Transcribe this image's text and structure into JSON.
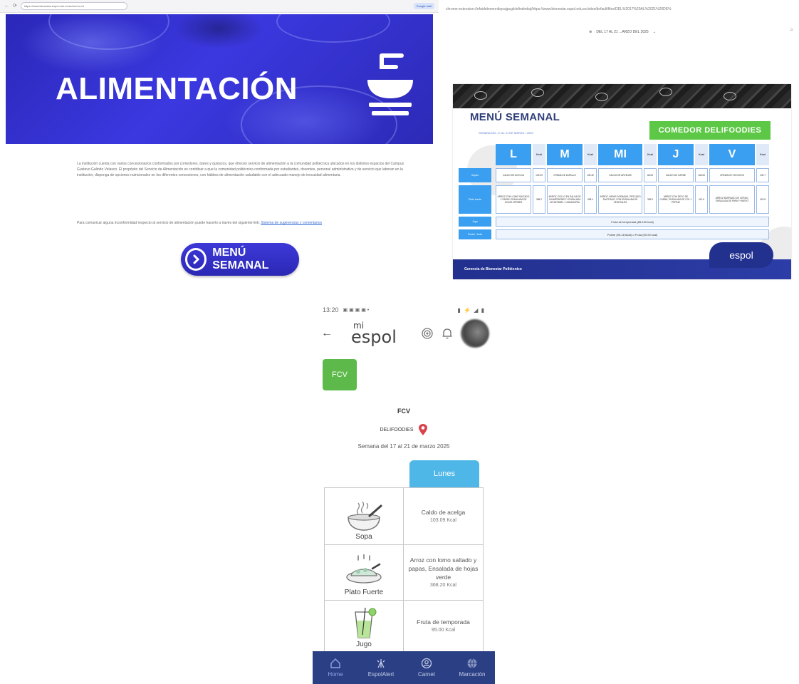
{
  "website": {
    "url": "https://www.bienestar.espol.edu.ec/es/menu-cvl",
    "browser_button": "Google mail",
    "hero_title": "ALIMENTACIÓN",
    "paragraph": "La institución cuenta con varios concesionarios conformados por comedores, bares y quioscos, que ofrecen servicio de alimentación a la comunidad politécnica ubicados en los distintos espacios del Campus Gustavo Galindo Velasco. El propósito del Servicio de Alimentación es contribuir a que la comunidad politécnica conformada por estudiantes, docentes, personal administrativo y de servicio que laboran en la institución, disponga de opciones nutricionales en los diferentes concesiones, con hábitos de alimentación saludable con el adecuado manejo de inocuidad alimentaria.",
    "contact_text": "Para comunicar alguna inconformidad respecto al servicio de alimentación puede hacerlo a través del siguiente link:",
    "contact_link": "Sistema de sugerencias y comentarios",
    "menu_button": "MENÚ SEMANAL"
  },
  "pdf": {
    "url": "chrome-extension://efaidnbmnnnibpcajpcglclefindmkaj/https://www.bienestar.espol.edu.ec/sites/default/files/DEL%2017%20AL%2021%20DE%",
    "toolbar_title": "DEL 17 AL 21 ...ARZO DEL 2025",
    "title": "MENÚ SEMANAL",
    "subtitle": "SEMANA DEL 17 AL 21 DE MARZO / 2025",
    "comedor": "COMEDOR DELIFOODIES",
    "kcal_label": "Kcal",
    "days": [
      "L",
      "M",
      "MI",
      "J",
      "V"
    ],
    "row_labels": [
      "Sopas",
      "Plato fuerte",
      "Jugo",
      "Postre / fruta"
    ],
    "sopas": [
      {
        "text": "CALDO DE ACELGA",
        "kcal": "103.09"
      },
      {
        "text": "CREMA DE ZAPALLO",
        "kcal": "135.42"
      },
      {
        "text": "CALDO DE ARVEJAS",
        "kcal": "86.05"
      },
      {
        "text": "CALDO DE CARNE",
        "kcal": "108.54"
      },
      {
        "text": "CREMA DE CHOCHOS",
        "kcal": "139.7"
      }
    ],
    "fuerte": [
      {
        "text": "ARROZ CON LOMO SALTADO Y PAPAS, ENSALADA DE HOJAS VERDES",
        "kcal": "368.2"
      },
      {
        "text": "ARROZ, POLLO EN SALSA DE CHAMPIÑONES Y ENSALADA DE BETABEL Y ZANAHORIA",
        "kcal": "398.4"
      },
      {
        "text": "ARROZ, PAPAS DORADAS, PESCADO SALTEADO, CON ENSALADA DE VEGETALES",
        "kcal": "383.5"
      },
      {
        "text": "ARROZ CON SECO DE CARNE, ENSALADA DE COL Y PEPINO",
        "kcal": "412.6"
      },
      {
        "text": "ARROZ BORRADO DE CERDO, ENSALADA DE PAPA Y HUEVO",
        "kcal": "403.8"
      }
    ],
    "jugo": "Fruta de temporada (85-100 kcal)",
    "postre": "Postre (90-110kcal) o Fruta (50-90 kcal)",
    "footer": "Gerencia de Bienestar Politécnico",
    "brand": "espol"
  },
  "phone": {
    "time": "13:20",
    "status_right": "▮ ⚡ ◢ ▮",
    "logo_mi": "mi",
    "logo": "espol",
    "tile": "FCV",
    "place_title": "FCV",
    "comedor": "DELIFOODIES",
    "week": "Semana del 17 al 21 de marzo 2025",
    "tab": "Lunes",
    "items": [
      {
        "name": "Sopa",
        "desc": "Caldo de acelga",
        "kcal": "103.09 Kcal"
      },
      {
        "name": "Plato Fuerte",
        "desc": "Arroz con lomo saltado y papas, Ensalada de hojas verde",
        "kcal": "368.20 Kcal"
      },
      {
        "name": "Jugo",
        "desc": "Fruta de temporada",
        "kcal": "95.00 Kcal"
      }
    ],
    "nav": [
      "Home",
      "EspolAlert",
      "Carnet",
      "Marcación"
    ]
  }
}
